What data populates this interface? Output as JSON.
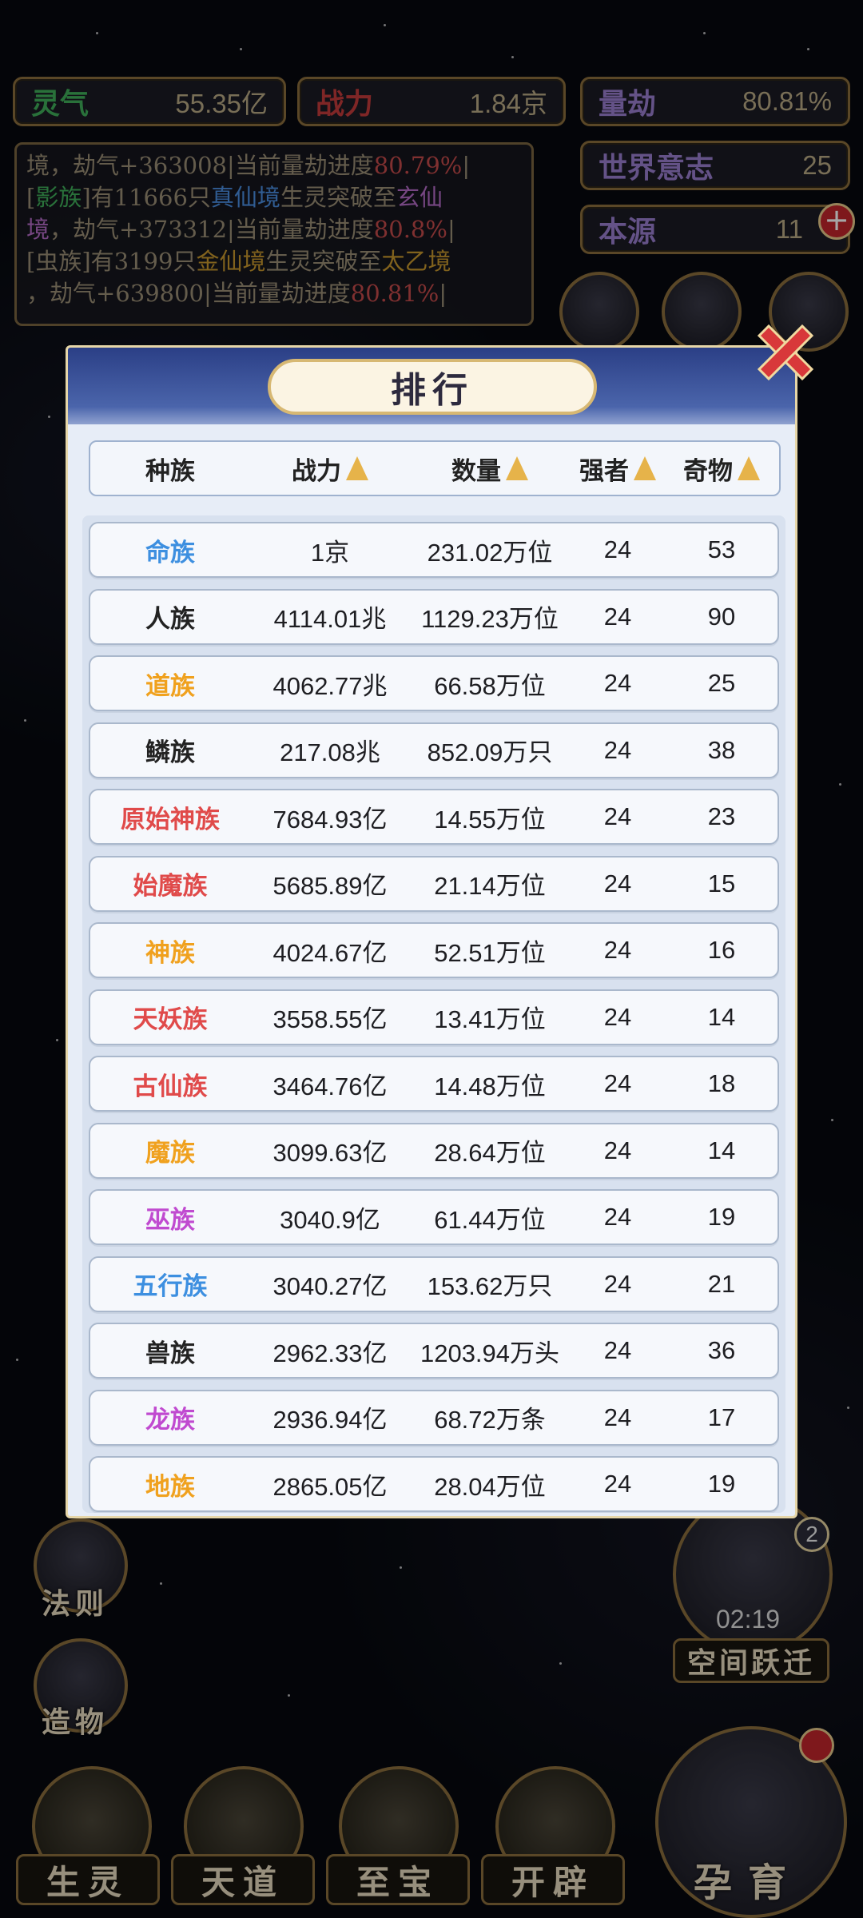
{
  "hud": {
    "lingqi": {
      "label": "灵气",
      "value": "55.35亿"
    },
    "zhanli": {
      "label": "战力",
      "value": "1.84京"
    },
    "liangjie": {
      "label": "量劫",
      "value": "80.81%"
    },
    "shijie_yizhi": {
      "label": "世界意志",
      "value": "25"
    },
    "benyuan": {
      "label": "本源",
      "value": "11"
    }
  },
  "log": {
    "lines": [
      [
        {
          "t": "境，劫气+363008|当前量劫进度",
          "c": ""
        },
        {
          "t": "80.79%",
          "c": "c-red"
        },
        {
          "t": "|",
          "c": ""
        }
      ],
      [
        {
          "t": "[",
          "c": ""
        },
        {
          "t": "影族",
          "c": "c-green"
        },
        {
          "t": "]有11666只",
          "c": ""
        },
        {
          "t": "真仙境",
          "c": "c-blue"
        },
        {
          "t": "生灵突破至",
          "c": ""
        },
        {
          "t": "玄仙",
          "c": "c-purple"
        }
      ],
      [
        {
          "t": "境",
          "c": "c-purple"
        },
        {
          "t": "，劫气+373312|当前量劫进度",
          "c": ""
        },
        {
          "t": "80.8%",
          "c": "c-red"
        },
        {
          "t": "|",
          "c": ""
        }
      ],
      [
        {
          "t": "[虫族]有3199只",
          "c": ""
        },
        {
          "t": "金仙境",
          "c": "c-gold"
        },
        {
          "t": "生灵突破至",
          "c": ""
        },
        {
          "t": "太乙境",
          "c": "c-gold"
        }
      ],
      [
        {
          "t": "，劫气+639800|当前量劫进度",
          "c": ""
        },
        {
          "t": "80.81%",
          "c": "c-red"
        },
        {
          "t": "|",
          "c": ""
        }
      ]
    ]
  },
  "side_buttons_left": [
    "法则",
    "造物"
  ],
  "side_buttons_right": {
    "timer": "02:19",
    "label": "空间跃迁",
    "badge": "2"
  },
  "bottom_nav": [
    "生灵",
    "天道",
    "至宝",
    "开辟",
    "孕育"
  ],
  "modal": {
    "title": "排行",
    "columns": [
      "种族",
      "战力",
      "数量",
      "强者",
      "奇物"
    ],
    "rows": [
      {
        "name": "命族",
        "color": "#3d8fe0",
        "power": "1京",
        "count": "231.02万位",
        "strong": "24",
        "relic": "53"
      },
      {
        "name": "人族",
        "color": "#222222",
        "power": "4114.01兆",
        "count": "1129.23万位",
        "strong": "24",
        "relic": "90"
      },
      {
        "name": "道族",
        "color": "#f0a11e",
        "power": "4062.77兆",
        "count": "66.58万位",
        "strong": "24",
        "relic": "25"
      },
      {
        "name": "鳞族",
        "color": "#222222",
        "power": "217.08兆",
        "count": "852.09万只",
        "strong": "24",
        "relic": "38"
      },
      {
        "name": "原始神族",
        "color": "#e04a4a",
        "power": "7684.93亿",
        "count": "14.55万位",
        "strong": "24",
        "relic": "23"
      },
      {
        "name": "始魔族",
        "color": "#e04a4a",
        "power": "5685.89亿",
        "count": "21.14万位",
        "strong": "24",
        "relic": "15"
      },
      {
        "name": "神族",
        "color": "#f0a11e",
        "power": "4024.67亿",
        "count": "52.51万位",
        "strong": "24",
        "relic": "16"
      },
      {
        "name": "天妖族",
        "color": "#e04a4a",
        "power": "3558.55亿",
        "count": "13.41万位",
        "strong": "24",
        "relic": "14"
      },
      {
        "name": "古仙族",
        "color": "#e04a4a",
        "power": "3464.76亿",
        "count": "14.48万位",
        "strong": "24",
        "relic": "18"
      },
      {
        "name": "魔族",
        "color": "#f0a11e",
        "power": "3099.63亿",
        "count": "28.64万位",
        "strong": "24",
        "relic": "14"
      },
      {
        "name": "巫族",
        "color": "#c04ad0",
        "power": "3040.9亿",
        "count": "61.44万位",
        "strong": "24",
        "relic": "19"
      },
      {
        "name": "五行族",
        "color": "#3d8fe0",
        "power": "3040.27亿",
        "count": "153.62万只",
        "strong": "24",
        "relic": "21"
      },
      {
        "name": "兽族",
        "color": "#222222",
        "power": "2962.33亿",
        "count": "1203.94万头",
        "strong": "24",
        "relic": "36"
      },
      {
        "name": "龙族",
        "color": "#c04ad0",
        "power": "2936.94亿",
        "count": "68.72万条",
        "strong": "24",
        "relic": "17"
      },
      {
        "name": "地族",
        "color": "#f0a11e",
        "power": "2865.05亿",
        "count": "28.04万位",
        "strong": "24",
        "relic": "19"
      }
    ]
  }
}
